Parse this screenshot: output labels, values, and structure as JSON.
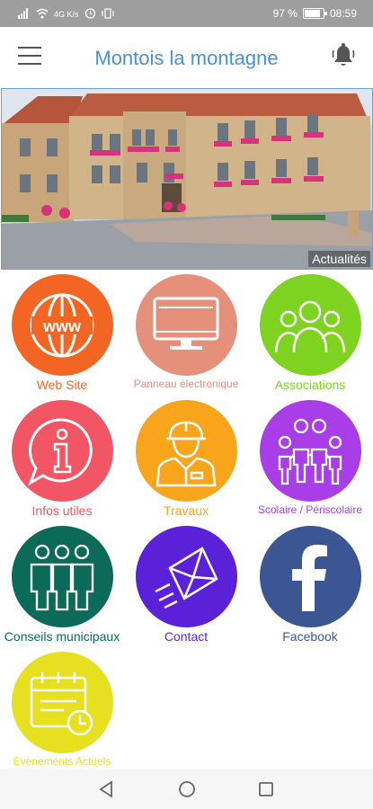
{
  "status_bar": {
    "left_text": "4G  K/s",
    "battery": "97 %",
    "time": "08:59",
    "battery_level": 0.97
  },
  "app": {
    "title": "Montois la montagne"
  },
  "hero": {
    "label": "Actualités"
  },
  "tiles": [
    {
      "label": "Web Site",
      "color": "#f26522",
      "label_color": "#f26522",
      "icon": "www-globe-icon"
    },
    {
      "label": "Panneau électronique",
      "color": "#e4907a",
      "label_color": "#e4907a",
      "icon": "monitor-icon"
    },
    {
      "label": "Associations",
      "color": "#7ed321",
      "label_color": "#7ed321",
      "icon": "people-group-icon"
    },
    {
      "label": "Infos utiles",
      "color": "#f25563",
      "label_color": "#f25563",
      "icon": "info-bubble-icon"
    },
    {
      "label": "Travaux",
      "color": "#f8a51b",
      "label_color": "#f8a51b",
      "icon": "worker-icon"
    },
    {
      "label": "Scolaire / Périscolaire",
      "color": "#a93ee8",
      "label_color": "#a93ee8",
      "icon": "children-icon"
    },
    {
      "label": "Conseils municipaux",
      "color": "#0b6b58",
      "label_color": "#0b6b58",
      "icon": "council-icon"
    },
    {
      "label": "Contact",
      "color": "#5b21d9",
      "label_color": "#5b21d9",
      "icon": "envelope-icon"
    },
    {
      "label": "Facebook",
      "color": "#3b5693",
      "label_color": "#3b5693",
      "icon": "facebook-icon"
    },
    {
      "label": "Evènements Actuels",
      "color": "#e6e020",
      "label_color": "#e6e020",
      "icon": "calendar-clock-icon"
    }
  ]
}
